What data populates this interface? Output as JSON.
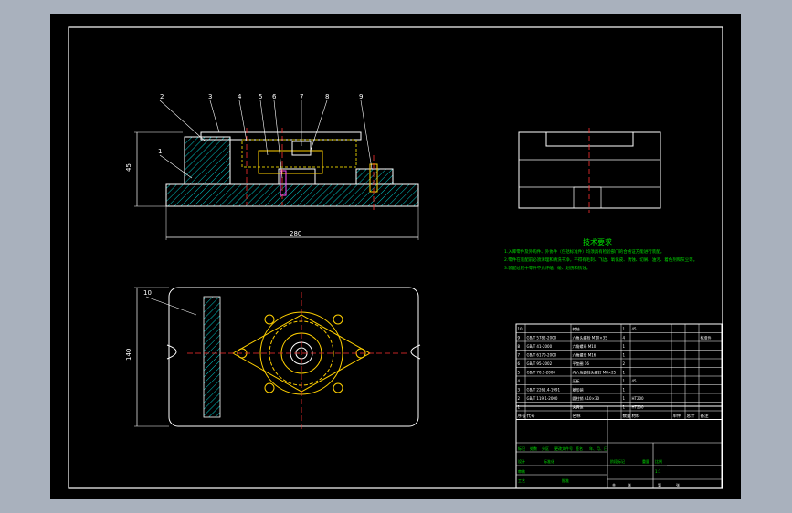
{
  "drawing": {
    "background_color": "#a9b1bd",
    "sheet_color": "#000000",
    "line_colors": {
      "outline": "#ffffff",
      "hatch": "#00c8c8",
      "hidden": "#d4c000",
      "center": "#ff3030",
      "part": "#ffd000",
      "table": "#ffffff"
    },
    "balloons": [
      "1",
      "2",
      "3",
      "4",
      "5",
      "6",
      "7",
      "8",
      "9",
      "10"
    ],
    "dim_height": "45",
    "dim_length": "280",
    "dim_width": "140"
  },
  "notes": {
    "title": "技术要求",
    "lines": [
      "1.入库零件及外购件、外协件（包括标准件）均须具有检验部门的合格证方能进行装配。",
      "2.零件在装配前必须清理和清洗干净，不得有毛刺、飞边、氧化皮、锈蚀、切屑、油污、着色剂和灰尘等。",
      "3.装配过程中零件不允许磕、碰、划伤和锈蚀。"
    ]
  },
  "bom": {
    "rows": [
      {
        "no": "10",
        "code": "",
        "name": "转轴",
        "qty": "1",
        "material": "45",
        "note": ""
      },
      {
        "no": "9",
        "code": "GB/T 5782-2000",
        "name": "六角头螺栓 M10×35",
        "qty": "4",
        "material": "",
        "note": "标准件"
      },
      {
        "no": "8",
        "code": "GB/T 41-2000",
        "name": "六角螺母 M10",
        "qty": "1",
        "material": "",
        "note": ""
      },
      {
        "no": "7",
        "code": "GB/T 6170-2000",
        "name": "六角螺母 M16",
        "qty": "1",
        "material": "",
        "note": ""
      },
      {
        "no": "6",
        "code": "GB/T 95-2002",
        "name": "平垫圈 16",
        "qty": "2",
        "material": "",
        "note": ""
      },
      {
        "no": "5",
        "code": "GB/T 70.1-2000",
        "name": "内六角圆柱头螺钉 M8×25",
        "qty": "1",
        "material": "",
        "note": ""
      },
      {
        "no": "4",
        "code": "",
        "name": "压板",
        "qty": "1",
        "material": "45",
        "note": ""
      },
      {
        "no": "3",
        "code": "GB/T 2261.4-1991",
        "name": "菱形销",
        "qty": "1",
        "material": "",
        "note": ""
      },
      {
        "no": "2",
        "code": "GB/T 119.1-2000",
        "name": "圆柱销 A10×30",
        "qty": "1",
        "material": "HT200",
        "note": ""
      },
      {
        "no": "1",
        "code": "",
        "name": "夹具体",
        "qty": "1",
        "material": "HT200",
        "note": ""
      }
    ],
    "header": {
      "no": "序号",
      "code": "代号",
      "name": "名称",
      "qty": "数量",
      "material": "材料",
      "unit_weight": "单件",
      "total_weight": "总计",
      "note": "备注",
      "weight": "重量"
    }
  },
  "title_block": {
    "labels": [
      "标记",
      "处数",
      "分区",
      "更改文件号",
      "签名",
      "年、月、日"
    ],
    "labels2": [
      "设计",
      "标准化",
      "阶段标记",
      "重量",
      "比例"
    ],
    "labels3": [
      "审核",
      "工艺",
      "批准"
    ],
    "scale": "1:1",
    "sheets": [
      "共",
      "张",
      "第",
      "张"
    ]
  }
}
